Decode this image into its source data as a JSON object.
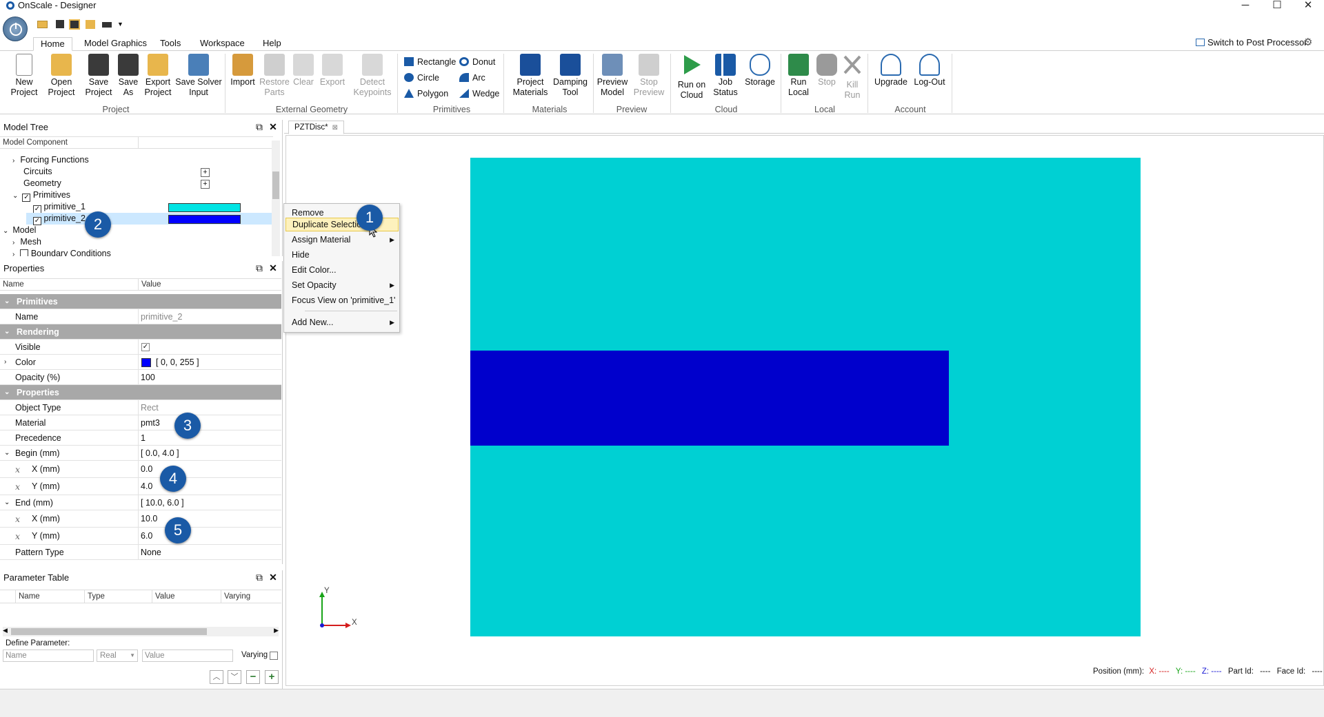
{
  "window": {
    "title": "OnScale - Designer",
    "minimize": "─",
    "maximize": "☐",
    "close": "✕"
  },
  "ribbon_tabs": [
    "Home",
    "Model Graphics",
    "Tools",
    "Workspace",
    "Help"
  ],
  "switch_label": "Switch to Post Processor",
  "ribbon": {
    "groups": {
      "project": "Project",
      "external": "External Geometry",
      "primitives": "Primitives",
      "materials": "Materials",
      "preview": "Preview",
      "cloud": "Cloud",
      "local": "Local",
      "account": "Account"
    },
    "buttons": {
      "new_project": [
        "New",
        "Project"
      ],
      "open_project": [
        "Open",
        "Project"
      ],
      "save_project": [
        "Save",
        "Project"
      ],
      "save_as": [
        "Save",
        "As"
      ],
      "export_project": [
        "Export",
        "Project"
      ],
      "save_solver": [
        "Save Solver",
        "Input"
      ],
      "import": [
        "Import",
        ""
      ],
      "restore_parts": [
        "Restore",
        "Parts"
      ],
      "clear": [
        "Clear",
        ""
      ],
      "export": [
        "Export",
        ""
      ],
      "detect_keypoints": [
        "Detect",
        "Keypoints"
      ],
      "project_materials": [
        "Project",
        "Materials"
      ],
      "damping_tool": [
        "Damping",
        "Tool"
      ],
      "preview_model": [
        "Preview",
        "Model"
      ],
      "stop_preview": [
        "Stop",
        "Preview"
      ],
      "run_on_cloud": [
        "Run on",
        "Cloud"
      ],
      "job_status": [
        "Job",
        "Status"
      ],
      "storage": [
        "Storage",
        ""
      ],
      "run_local": [
        "Run",
        "Local"
      ],
      "stop": [
        "Stop",
        ""
      ],
      "kill_run": [
        "Kill",
        "Run"
      ],
      "upgrade": [
        "Upgrade",
        ""
      ],
      "logout": [
        "Log-Out",
        ""
      ]
    },
    "primitives": {
      "rectangle": "Rectangle",
      "donut": "Donut",
      "circle": "Circle",
      "arc": "Arc",
      "polygon": "Polygon",
      "wedge": "Wedge"
    }
  },
  "model_tree": {
    "title": "Model Tree",
    "col": "Model Component",
    "items": [
      "Forcing Functions",
      "Circuits",
      "Geometry",
      "Primitives",
      "primitive_1",
      "primitive_2",
      "Model",
      "Mesh",
      "Boundary Conditions"
    ],
    "plus": "+"
  },
  "colors": {
    "primitive_1": "#00d0d3",
    "primitive_2": "#0000ff",
    "accent": "#1a5aa6"
  },
  "properties": {
    "title": "Properties",
    "col_name": "Name",
    "col_value": "Value",
    "rows": [
      {
        "name": "Primitives",
        "value": ""
      },
      {
        "name": "Name",
        "value": "primitive_2"
      },
      {
        "name": "Rendering",
        "value": ""
      },
      {
        "name": "Visible",
        "value": "✓"
      },
      {
        "name": "Color",
        "value": "[ 0, 0, 255 ]"
      },
      {
        "name": "Opacity (%)",
        "value": "100"
      },
      {
        "name": "Properties",
        "value": ""
      },
      {
        "name": "Object Type",
        "value": "Rect"
      },
      {
        "name": "Material",
        "value": "pmt3"
      },
      {
        "name": "Precedence",
        "value": "1"
      },
      {
        "name": "Begin (mm)",
        "value": "[ 0.0, 4.0 ]"
      },
      {
        "name": "X (mm)",
        "value": "0.0"
      },
      {
        "name": "Y (mm)",
        "value": "4.0"
      },
      {
        "name": "End (mm)",
        "value": "[ 10.0, 6.0 ]"
      },
      {
        "name": "X (mm)",
        "value": "10.0"
      },
      {
        "name": "Y (mm)",
        "value": "6.0"
      },
      {
        "name": "Pattern Type",
        "value": "None"
      }
    ]
  },
  "param_table": {
    "title": "Parameter Table",
    "cols": [
      "Name",
      "Type",
      "Value",
      "Varying"
    ],
    "define": "Define Parameter:",
    "name_ph": "Name",
    "type_val": "Real",
    "value_ph": "Value",
    "varying": "Varying"
  },
  "doc_tab": "PZTDisc*",
  "context_menu": {
    "items": [
      "Remove",
      "Duplicate Selection",
      "Assign Material",
      "Hide",
      "Edit Color...",
      "Set Opacity",
      "Focus View on 'primitive_1'",
      "Add New..."
    ],
    "highlighted": "Duplicate Selection"
  },
  "badges": [
    "1",
    "2",
    "3",
    "4",
    "5"
  ],
  "axis": {
    "x": "X",
    "y": "Y"
  },
  "status": {
    "position_label": "Position (mm):",
    "x": "X: ----",
    "y": "Y: ----",
    "z": "Z: ----",
    "part": "Part Id:",
    "part_val": "----",
    "face": "Face Id:",
    "face_val": "----"
  }
}
